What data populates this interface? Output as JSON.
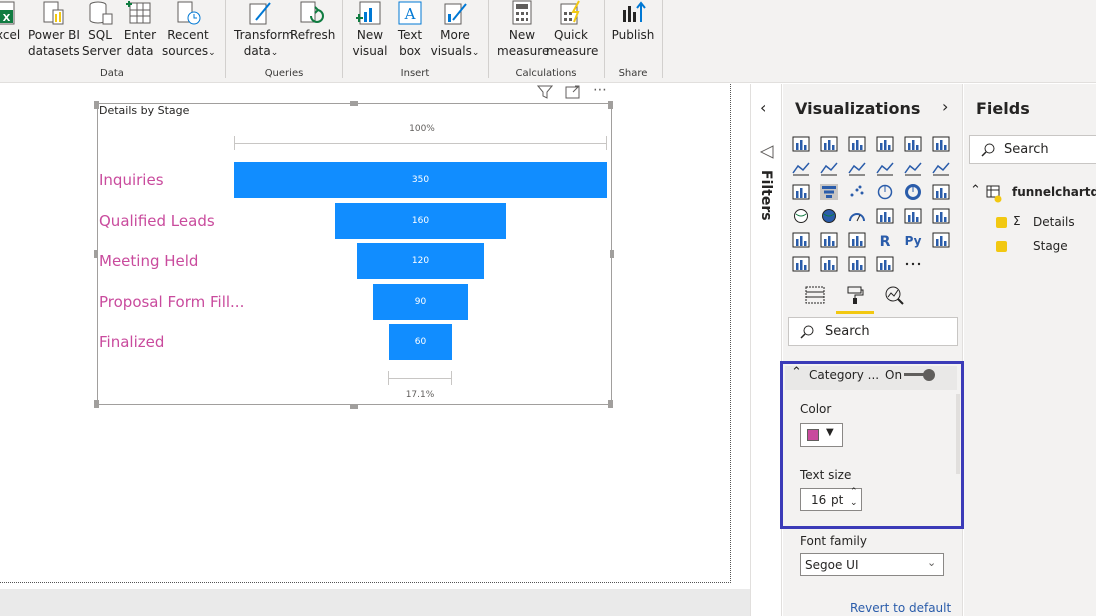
{
  "ribbon": {
    "buttons": {
      "excel": {
        "label": "xcel"
      },
      "powerbi": {
        "line1": "Power BI",
        "line2": "datasets"
      },
      "sql": {
        "line1": "SQL",
        "line2": "Server"
      },
      "enter": {
        "line1": "Enter",
        "line2": "data"
      },
      "recent": {
        "line1": "Recent",
        "line2": "sources"
      },
      "transform": {
        "line1": "Transform",
        "line2": "data"
      },
      "refresh": {
        "label": "Refresh"
      },
      "new_visual": {
        "line1": "New",
        "line2": "visual"
      },
      "text_box": {
        "line1": "Text",
        "line2": "box"
      },
      "more_visuals": {
        "line1": "More",
        "line2": "visuals"
      },
      "new_measure": {
        "line1": "New",
        "line2": "measure"
      },
      "quick_measure": {
        "line1": "Quick",
        "line2": "measure"
      },
      "publish": {
        "label": "Publish"
      }
    },
    "groups": {
      "data": "Data",
      "queries": "Queries",
      "insert": "Insert",
      "calculations": "Calculations",
      "share": "Share"
    }
  },
  "visual": {
    "title": "Details by Stage",
    "top_pct": "100%",
    "bottom_pct": "17.1%",
    "category_color": "#c94b9d",
    "bar_color": "#118dff"
  },
  "chart_data": {
    "type": "funnel",
    "categories": [
      "Inquiries",
      "Qualified Leads",
      "Meeting Held",
      "Proposal Form Fill...",
      "Finalized"
    ],
    "values": [
      350,
      160,
      120,
      90,
      60
    ],
    "title": "Details by Stage"
  },
  "filters": {
    "label": "Filters"
  },
  "visualizations": {
    "title": "Visualizations",
    "search_placeholder": "Search",
    "category": {
      "label": "Category ...",
      "toggle": "On"
    },
    "color_label": "Color",
    "text_size_label": "Text size",
    "text_size_value": "16",
    "text_size_unit": "pt",
    "font_family_label": "Font family",
    "font_family_value": "Segoe UI",
    "revert": "Revert to default"
  },
  "fields": {
    "title": "Fields",
    "search_placeholder": "Search",
    "table": "funnelchartdata",
    "items": [
      "Details",
      "Stage"
    ]
  }
}
